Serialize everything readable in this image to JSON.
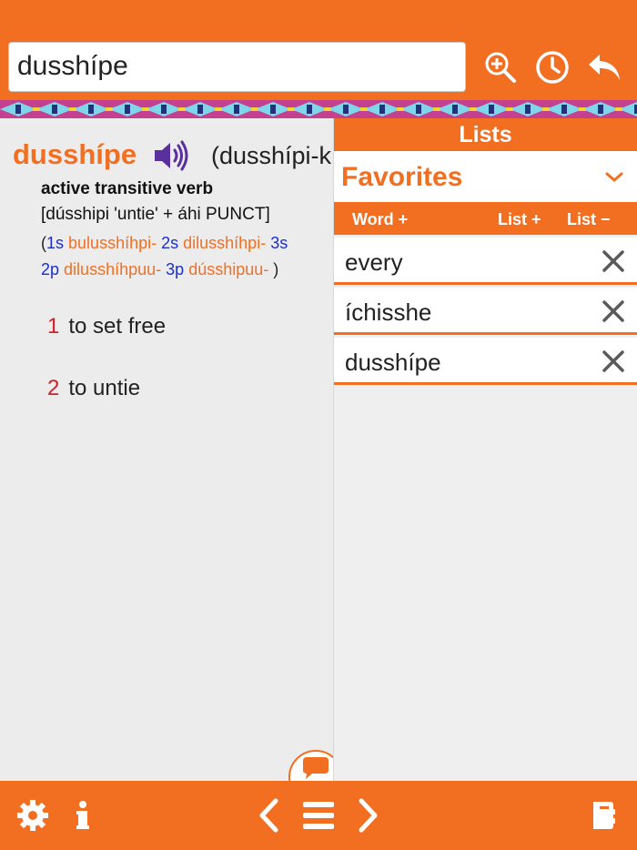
{
  "search": {
    "value": "dusshípe"
  },
  "icons": {
    "zoom": "zoom-in-icon",
    "history": "clock-icon",
    "back": "reply-arrow-icon",
    "audio": "speaker-icon",
    "settings": "gear-icon",
    "info": "info-icon",
    "prev": "chevron-left-icon",
    "menu": "hamburger-menu-icon",
    "next": "chevron-right-icon",
    "book": "book-icon",
    "chat": "speech-bubble-icon",
    "remove": "close-x-icon",
    "dropdown": "chevron-down-icon"
  },
  "colors": {
    "brand": "#f26f21",
    "person_tag": "#1b2fd0",
    "sense_number": "#d0202a"
  },
  "entry": {
    "headword": "dusshípe",
    "stem": "(dusshípi-k",
    "part_of_speech": "active transitive verb",
    "etymology": "[dússhipi 'untie' + áhi PUNCT]",
    "conjugation": {
      "open": "(",
      "row1": [
        {
          "tag": "1s",
          "form": "bulusshíhpi-"
        },
        {
          "tag": "2s",
          "form": "dilusshíhpi-"
        },
        {
          "tag": "3s",
          "form": ""
        }
      ],
      "row2": [
        {
          "tag": "2p",
          "form": "dilusshíhpuu-"
        },
        {
          "tag": "3p",
          "form": "dússhipuu-"
        }
      ],
      "close": ")"
    },
    "senses": [
      {
        "num": "1",
        "text": "to set free"
      },
      {
        "num": "2",
        "text": "to untie"
      }
    ]
  },
  "lists": {
    "title": "Lists",
    "selected_list": "Favorites",
    "actions": {
      "word_add": "Word +",
      "list_add": "List +",
      "list_remove": "List −"
    },
    "items": [
      {
        "word": "every"
      },
      {
        "word": "íchisshe"
      },
      {
        "word": "dusshípe"
      }
    ]
  }
}
